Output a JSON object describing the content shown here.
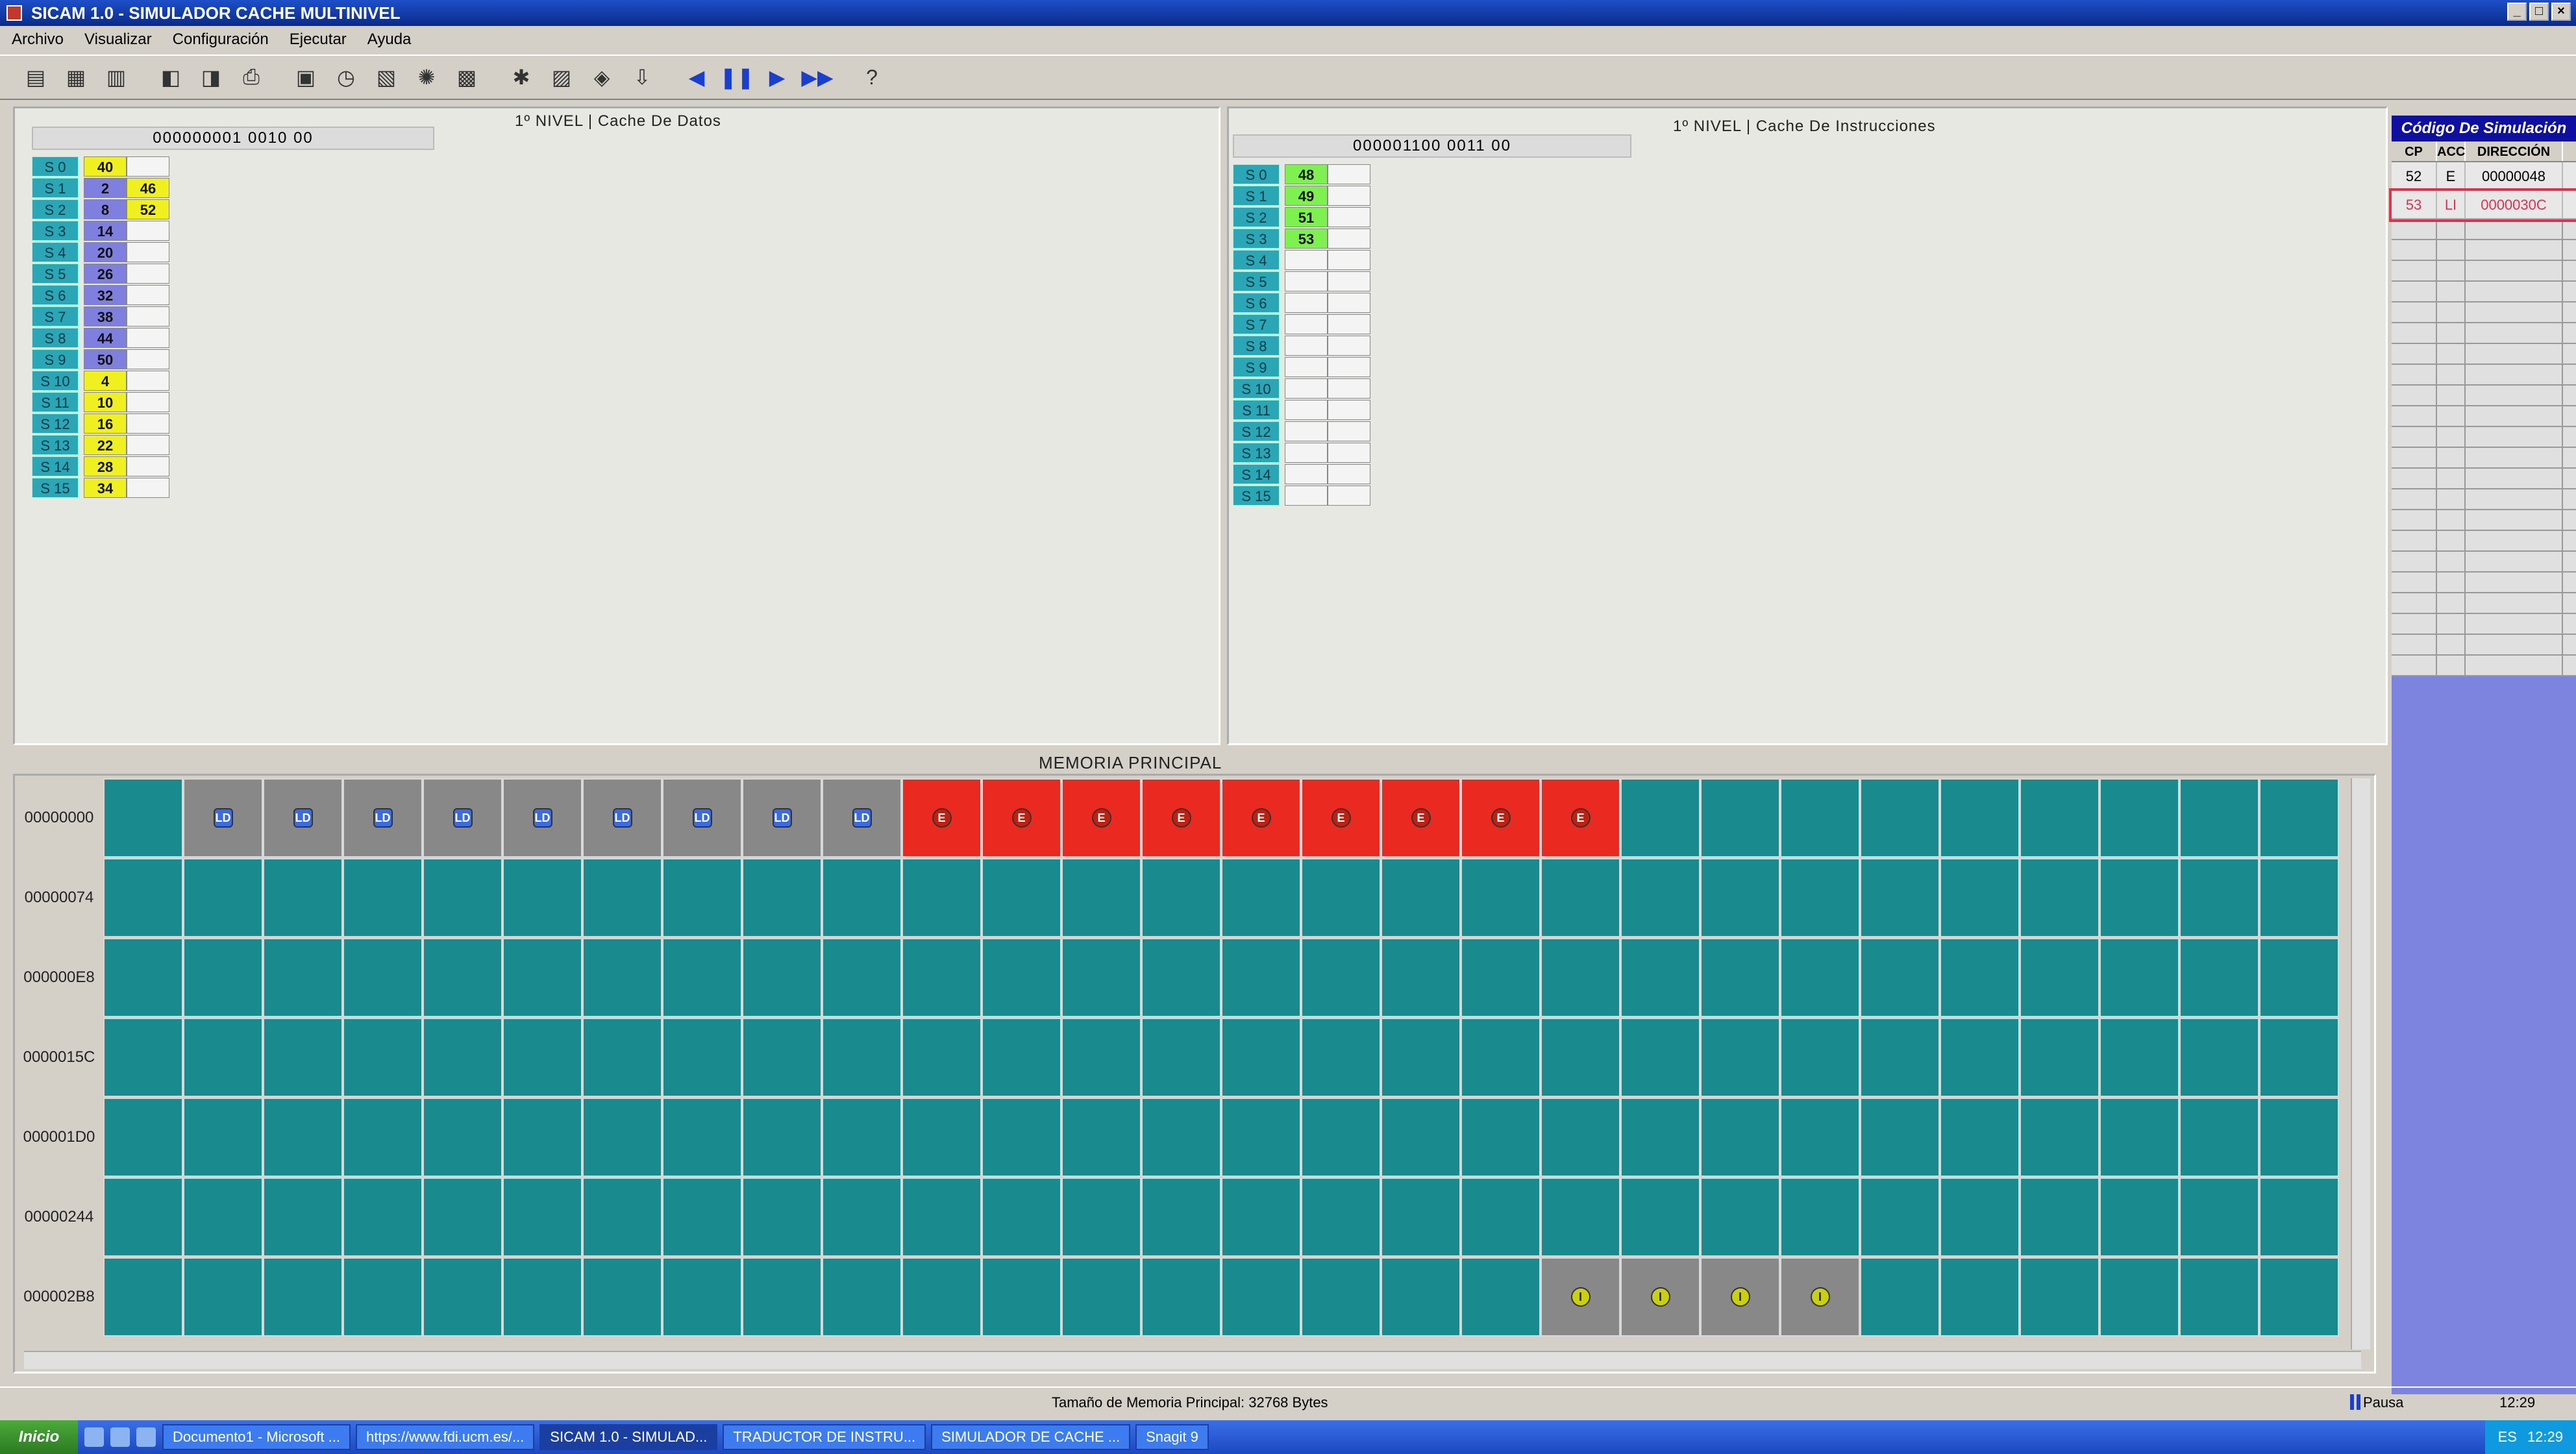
{
  "window": {
    "title": "SICAM 1.0 - SIMULADOR CACHE MULTINIVEL"
  },
  "menu": [
    "Archivo",
    "Visualizar",
    "Configuración",
    "Ejecutar",
    "Ayuda"
  ],
  "toolbar_icons": [
    "new-icon",
    "open-code-icon",
    "open-data-icon",
    "separator",
    "save-icon",
    "load-icon",
    "print-icon",
    "separator",
    "chart-icon",
    "clock-icon",
    "report-icon",
    "settings-icon",
    "memory-icon",
    "separator",
    "hit-icon",
    "cache-icon",
    "map-icon",
    "down-icon",
    "separator",
    "rewind-icon",
    "pause-icon",
    "play-icon",
    "fast-forward-icon",
    "separator",
    "help-icon"
  ],
  "data_cache": {
    "title": "1º NIVEL | Cache De Datos",
    "address": "000000001  0010   00",
    "rows": [
      {
        "label": "S 0",
        "v1": "40",
        "c1": "y",
        "v2": ""
      },
      {
        "label": "S 1",
        "v1": "2",
        "c1": "p",
        "v2": "46"
      },
      {
        "label": "S 2",
        "v1": "8",
        "c1": "p",
        "v2": "52"
      },
      {
        "label": "S 3",
        "v1": "14",
        "c1": "p",
        "v2": ""
      },
      {
        "label": "S 4",
        "v1": "20",
        "c1": "p",
        "v2": ""
      },
      {
        "label": "S 5",
        "v1": "26",
        "c1": "p",
        "v2": ""
      },
      {
        "label": "S 6",
        "v1": "32",
        "c1": "p",
        "v2": ""
      },
      {
        "label": "S 7",
        "v1": "38",
        "c1": "p",
        "v2": ""
      },
      {
        "label": "S 8",
        "v1": "44",
        "c1": "p",
        "v2": ""
      },
      {
        "label": "S 9",
        "v1": "50",
        "c1": "p",
        "v2": ""
      },
      {
        "label": "S 10",
        "v1": "4",
        "c1": "y",
        "v2": ""
      },
      {
        "label": "S 11",
        "v1": "10",
        "c1": "y",
        "v2": ""
      },
      {
        "label": "S 12",
        "v1": "16",
        "c1": "y",
        "v2": ""
      },
      {
        "label": "S 13",
        "v1": "22",
        "c1": "y",
        "v2": ""
      },
      {
        "label": "S 14",
        "v1": "28",
        "c1": "y",
        "v2": ""
      },
      {
        "label": "S 15",
        "v1": "34",
        "c1": "y",
        "v2": ""
      }
    ]
  },
  "instr_cache": {
    "title": "1º NIVEL | Cache De Instrucciones",
    "address": "000001100  0011   00",
    "rows": [
      {
        "label": "S 0",
        "v1": "48",
        "c1": "g"
      },
      {
        "label": "S 1",
        "v1": "49",
        "c1": "g"
      },
      {
        "label": "S 2",
        "v1": "51",
        "c1": "g"
      },
      {
        "label": "S 3",
        "v1": "53",
        "c1": "g"
      },
      {
        "label": "S 4",
        "v1": "",
        "c1": "w"
      },
      {
        "label": "S 5",
        "v1": "",
        "c1": "w"
      },
      {
        "label": "S 6",
        "v1": "",
        "c1": "w"
      },
      {
        "label": "S 7",
        "v1": "",
        "c1": "w"
      },
      {
        "label": "S 8",
        "v1": "",
        "c1": "w"
      },
      {
        "label": "S 9",
        "v1": "",
        "c1": "w"
      },
      {
        "label": "S 10",
        "v1": "",
        "c1": "w"
      },
      {
        "label": "S 11",
        "v1": "",
        "c1": "w"
      },
      {
        "label": "S 12",
        "v1": "",
        "c1": "w"
      },
      {
        "label": "S 13",
        "v1": "",
        "c1": "w"
      },
      {
        "label": "S 14",
        "v1": "",
        "c1": "w"
      },
      {
        "label": "S 15",
        "v1": "",
        "c1": "w"
      }
    ]
  },
  "sim_code": {
    "title": "Código De Simulación",
    "headers": [
      "CP",
      "ACC",
      "DIRECCIÓN"
    ],
    "rows": [
      {
        "cp": "52",
        "acc": "E",
        "dir": "00000048",
        "highlight": false
      },
      {
        "cp": "53",
        "acc": "LI",
        "dir": "0000030C",
        "highlight": true
      }
    ]
  },
  "memory": {
    "title": "MEMORIA PRINCIPAL",
    "rows": [
      {
        "label": "00000000",
        "cells": [
          "",
          "LD",
          "LD",
          "LD",
          "LD",
          "LD",
          "LD",
          "LD",
          "LD",
          "LD",
          "E",
          "E",
          "E",
          "E",
          "E",
          "E",
          "E",
          "E",
          "E",
          "",
          "",
          "",
          "",
          "",
          "",
          "",
          "",
          ""
        ]
      },
      {
        "label": "00000074",
        "cells": []
      },
      {
        "label": "000000E8",
        "cells": []
      },
      {
        "label": "0000015C",
        "cells": []
      },
      {
        "label": "000001D0",
        "cells": []
      },
      {
        "label": "00000244",
        "cells": []
      },
      {
        "label": "000002B8",
        "cells": [
          "",
          "",
          "",
          "",
          "",
          "",
          "",
          "",
          "",
          "",
          "",
          "",
          "",
          "",
          "",
          "",
          "",
          "",
          "LI",
          "LI",
          "LI",
          "LI",
          "",
          "",
          "",
          "",
          "",
          ""
        ]
      }
    ]
  },
  "status": {
    "message": "Tamaño de Memoria Principal: 32768 Bytes",
    "state": "Pausa",
    "time": "12:29"
  },
  "taskbar": {
    "start": "Inicio",
    "tasks": [
      {
        "label": "Documento1 - Microsoft ...",
        "active": false
      },
      {
        "label": "https://www.fdi.ucm.es/...",
        "active": false
      },
      {
        "label": "SICAM 1.0 - SIMULAD...",
        "active": true
      },
      {
        "label": "TRADUCTOR DE INSTRU...",
        "active": false
      },
      {
        "label": "SIMULADOR DE CACHE ...",
        "active": false
      },
      {
        "label": "Snagit 9",
        "active": false
      }
    ],
    "tray": [
      "ES",
      "12:29"
    ]
  }
}
